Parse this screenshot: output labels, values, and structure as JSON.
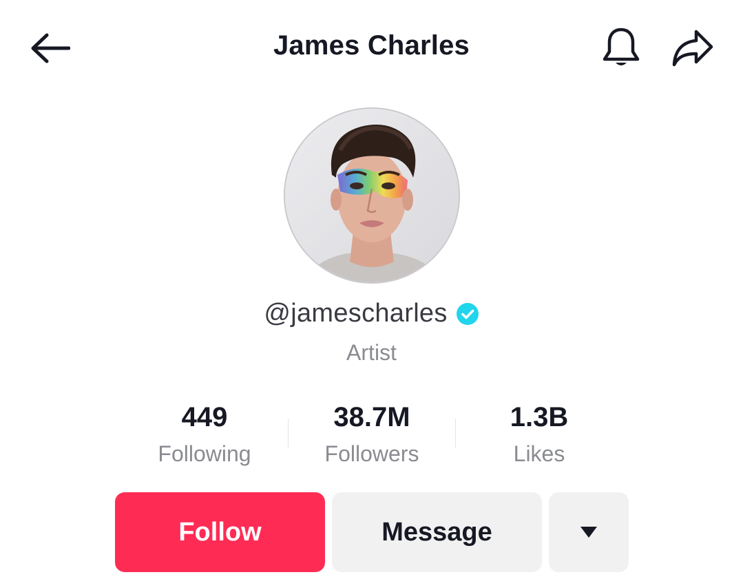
{
  "header": {
    "title": "James Charles",
    "back_icon": "arrow-left-icon",
    "bell_icon": "bell-icon",
    "share_icon": "share-arrow-icon"
  },
  "profile": {
    "username": "@jamescharles",
    "verified": true,
    "bio": "Artist",
    "verified_color": "#20d5ec"
  },
  "stats": [
    {
      "value": "449",
      "label": "Following"
    },
    {
      "value": "38.7M",
      "label": "Followers"
    },
    {
      "value": "1.3B",
      "label": "Likes"
    }
  ],
  "actions": {
    "follow_label": "Follow",
    "message_label": "Message",
    "more_icon": "caret-down-icon"
  },
  "colors": {
    "accent": "#fe2c55",
    "secondary_button": "#f1f1f2",
    "text_primary": "#161823",
    "text_secondary": "#8a8b91"
  }
}
